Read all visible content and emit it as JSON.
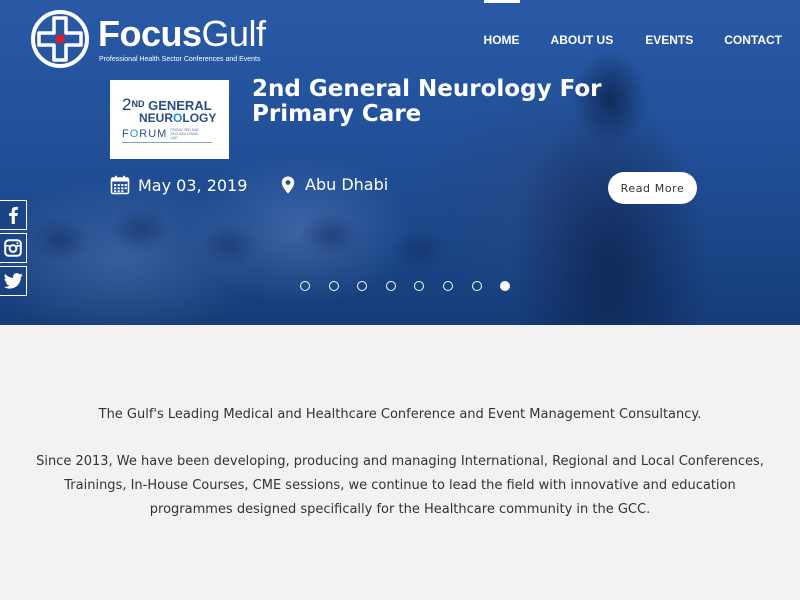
{
  "brand": {
    "name_part1": "Focus",
    "name_part2": "Gulf",
    "tagline": "Professional Health Sector Conferences and Events"
  },
  "nav": {
    "items": [
      {
        "label": "HOME",
        "active": true
      },
      {
        "label": "ABOUT US",
        "active": false
      },
      {
        "label": "EVENTS",
        "active": false
      },
      {
        "label": "CONTACT",
        "active": false
      }
    ]
  },
  "slide": {
    "thumb": {
      "line1_prefix": "2",
      "line1_sup": "ND",
      "line1_rest": "GENERAL",
      "line2_a": "NEUR",
      "line2_o": "O",
      "line2_b": "LOGY",
      "forum_a": "F",
      "forum_o": "O",
      "forum_b": "RUM",
      "small_text": "FRIDAY 3RD MAY 2019 ABU DHABI, UAE"
    },
    "title": "2nd General Neurology For Primary Care",
    "date": "May 03, 2019",
    "location": "Abu Dhabi",
    "cta": "Read More",
    "slide_count": 8,
    "active_slide": 8
  },
  "social": [
    "facebook-icon",
    "instagram-icon",
    "twitter-icon"
  ],
  "intro": {
    "headline": "The Gulf's Leading Medical and Healthcare Conference and Event Management Consultancy.",
    "body": "Since 2013, We have been developing, producing and managing International, Regional and Local Conferences, Trainings, In-House Courses, CME sessions, we continue to lead the field with innovative and education programmes designed specifically for the Healthcare community in the GCC."
  },
  "colors": {
    "hero_blue": "#22519a",
    "page_bg": "#f2f2f2",
    "text": "#333333",
    "logo_red": "#d9202a"
  }
}
